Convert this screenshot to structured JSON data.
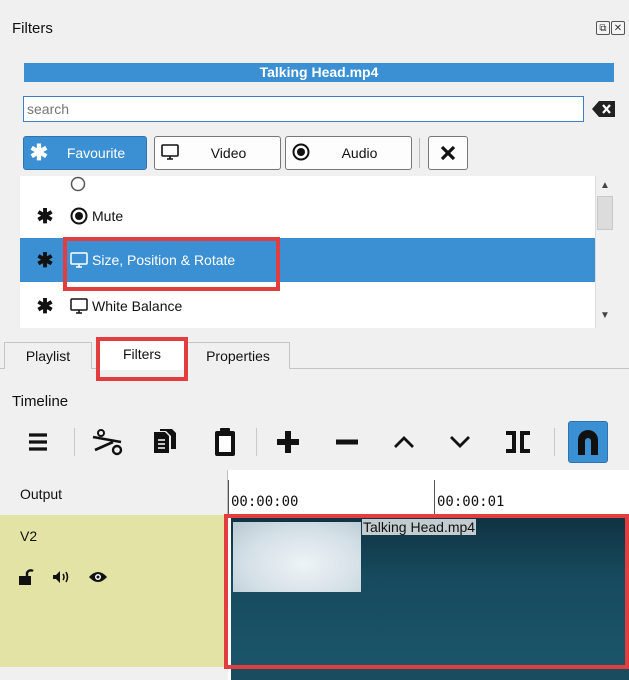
{
  "panel": {
    "title": "Filters",
    "clip_name": "Talking Head.mp4",
    "search": {
      "placeholder": "search",
      "value": ""
    },
    "filter_buttons": [
      {
        "label": "Favourite",
        "icon": "asterisk-icon",
        "active": true
      },
      {
        "label": "Video",
        "icon": "monitor-icon",
        "active": false
      },
      {
        "label": "Audio",
        "icon": "speaker-icon",
        "active": false
      }
    ],
    "list": [
      {
        "label": "Mute",
        "icon": "speaker-icon",
        "favourite": true,
        "selected": false
      },
      {
        "label": "Size, Position & Rotate",
        "icon": "monitor-icon",
        "favourite": true,
        "selected": true
      },
      {
        "label": "White Balance",
        "icon": "monitor-icon",
        "favourite": true,
        "selected": false
      }
    ]
  },
  "tabs": [
    {
      "label": "Playlist",
      "active": false
    },
    {
      "label": "Filters",
      "active": true
    },
    {
      "label": "Properties",
      "active": false
    }
  ],
  "timeline": {
    "title": "Timeline",
    "output_label": "Output",
    "ruler": [
      "00:00:00",
      "00:00:01"
    ],
    "track": {
      "name": "V2"
    },
    "clip_name": "Talking Head.mp4"
  },
  "colors": {
    "accent": "#3b8fd3",
    "highlight": "#e23d3f",
    "track_head": "#e3e3a6",
    "clip": "#174a5e"
  }
}
